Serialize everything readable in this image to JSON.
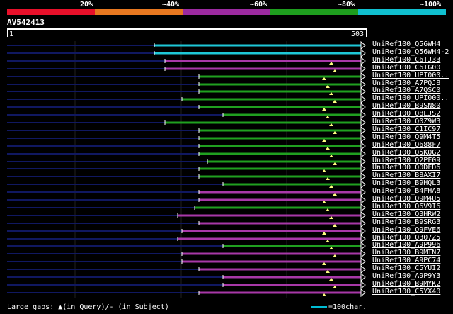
{
  "legend": {
    "labels": [
      "20%",
      "~40%",
      "~60%",
      "~80%",
      "~100%"
    ],
    "colors": [
      "#e8102a",
      "#e87820",
      "#9c2aa0",
      "#1e9e1e",
      "#10c0d0"
    ]
  },
  "query": {
    "name": "AV542413",
    "start": "1",
    "end": "503"
  },
  "colors": {
    "cyan": "#1ec8d8",
    "magenta": "#a838a8",
    "green": "#20a020",
    "query_line": "#101860"
  },
  "hits": [
    {
      "label": "UniRef100_Q56WH4",
      "color": "cyan"
    },
    {
      "label": "UniRef100_Q56WH4-2",
      "color": "cyan"
    },
    {
      "label": "UniRef100_C6TJ33",
      "color": "magenta"
    },
    {
      "label": "UniRef100_C6TG00",
      "color": "magenta"
    },
    {
      "label": "UniRef100_UPI000..",
      "color": "green"
    },
    {
      "label": "UniRef100_A7PQJ8",
      "color": "green"
    },
    {
      "label": "UniRef100_A7QSC0",
      "color": "green"
    },
    {
      "label": "UniRef100_UPI000..",
      "color": "green"
    },
    {
      "label": "UniRef100_B9SN80",
      "color": "green"
    },
    {
      "label": "UniRef100_Q8LJS2",
      "color": "green"
    },
    {
      "label": "UniRef100_Q0Z9W3",
      "color": "green"
    },
    {
      "label": "UniRef100_C1IC97",
      "color": "green"
    },
    {
      "label": "UniRef100_Q9M4T5",
      "color": "green"
    },
    {
      "label": "UniRef100_Q688F7",
      "color": "green"
    },
    {
      "label": "UniRef100_Q5KQG2",
      "color": "green"
    },
    {
      "label": "UniRef100_Q2PF09",
      "color": "green"
    },
    {
      "label": "UniRef100_Q0DFD6",
      "color": "green"
    },
    {
      "label": "UniRef100_B8AXI7",
      "color": "green"
    },
    {
      "label": "UniRef100_B9HQL3",
      "color": "green"
    },
    {
      "label": "UniRef100_B4FHA8",
      "color": "magenta"
    },
    {
      "label": "UniRef100_Q9M4U5",
      "color": "magenta"
    },
    {
      "label": "UniRef100_Q6V9I6",
      "color": "green"
    },
    {
      "label": "UniRef100_Q3HRW2",
      "color": "magenta"
    },
    {
      "label": "UniRef100_B9SRG3",
      "color": "magenta"
    },
    {
      "label": "UniRef100_Q9FVE6",
      "color": "magenta"
    },
    {
      "label": "UniRef100_Q307Z5",
      "color": "magenta"
    },
    {
      "label": "UniRef100_A9P996",
      "color": "green"
    },
    {
      "label": "UniRef100_B9MTN7",
      "color": "magenta"
    },
    {
      "label": "UniRef100_A9PC74",
      "color": "magenta"
    },
    {
      "label": "UniRef100_C5YUI2",
      "color": "magenta"
    },
    {
      "label": "UniRef100_A9P9Y3",
      "color": "magenta"
    },
    {
      "label": "UniRef100_B9MYK2",
      "color": "magenta"
    },
    {
      "label": "UniRef100_C5YX40",
      "color": "magenta"
    }
  ],
  "footer": {
    "large_gaps": "Large gaps: ▲(in Query)/- (in Subject)",
    "scale_label": "=100char."
  }
}
